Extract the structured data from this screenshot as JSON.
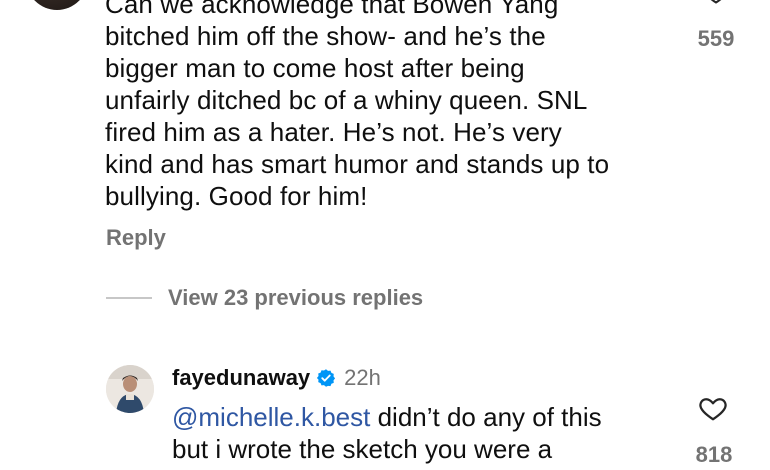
{
  "top_comment": {
    "lines": [
      "Can we acknowledge that Bowen Yang",
      "bitched him off the show- and he’s the",
      "bigger man to come host after being",
      "unfairly ditched bc of a whiny queen.  SNL",
      "fired him as a hater. He’s not. He’s very",
      "kind and has smart humor and stands up to",
      "bullying. Good for him!"
    ],
    "like_count": "559",
    "reply_label": "Reply"
  },
  "view_replies": {
    "label": "View 23 previous replies"
  },
  "reply_comment": {
    "username": "fayedunaway",
    "time": "22h",
    "mention": "@michelle.k.best",
    "line1_rest": " didn’t do any of this",
    "line2": "but i wrote the sketch you were a",
    "like_count": "818"
  },
  "colors": {
    "secondary_text": "#737373",
    "mention": "#2f57a3",
    "verified_badge": "#0095f6"
  },
  "icons": {
    "heart": "heart-outline-icon",
    "verified": "verified-badge-icon"
  }
}
